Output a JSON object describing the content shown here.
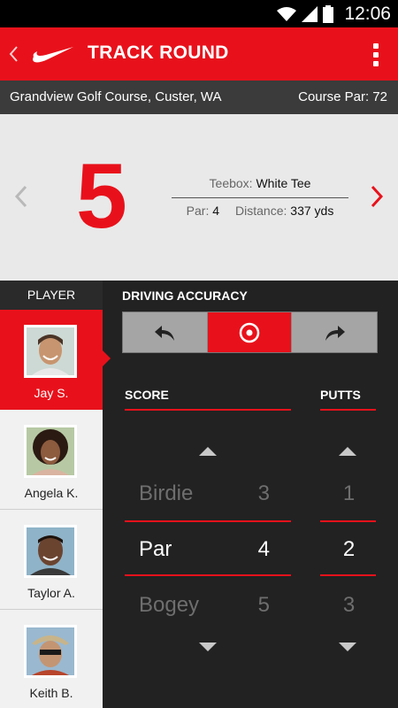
{
  "status": {
    "time": "12:06"
  },
  "header": {
    "title": "TRACK ROUND"
  },
  "course": {
    "name": "Grandview Golf Course, Custer, WA",
    "par_label": "Course Par: 72"
  },
  "hole": {
    "number": "5",
    "teebox_label": "Teebox:",
    "teebox_value": "White Tee",
    "par_label": "Par:",
    "par_value": "4",
    "distance_label": "Distance:",
    "distance_value": "337 yds"
  },
  "players": {
    "header": "PLAYER",
    "items": [
      {
        "name": "Jay S.",
        "active": true
      },
      {
        "name": "Angela K.",
        "active": false
      },
      {
        "name": "Taylor A.",
        "active": false
      },
      {
        "name": "Keith B.",
        "active": false
      }
    ]
  },
  "driving": {
    "label": "DRIVING ACCURACY",
    "options": [
      "left-icon",
      "target-icon",
      "right-icon"
    ],
    "selected": "target-icon"
  },
  "score": {
    "label": "SCORE",
    "rows": [
      {
        "name": "Birdie",
        "value": "3"
      },
      {
        "name": "Par",
        "value": "4"
      },
      {
        "name": "Bogey",
        "value": "5"
      }
    ],
    "selected": "Par"
  },
  "putts": {
    "label": "PUTTS",
    "values": [
      "1",
      "2",
      "3"
    ],
    "selected": "2"
  },
  "colors": {
    "accent": "#e8111b",
    "dark": "#222222",
    "panel": "#e9e9e9"
  }
}
